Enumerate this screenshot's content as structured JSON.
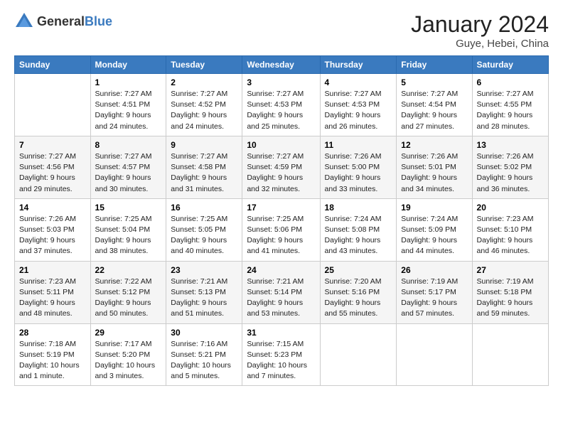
{
  "header": {
    "logo_general": "General",
    "logo_blue": "Blue",
    "month": "January 2024",
    "location": "Guye, Hebei, China"
  },
  "days_of_week": [
    "Sunday",
    "Monday",
    "Tuesday",
    "Wednesday",
    "Thursday",
    "Friday",
    "Saturday"
  ],
  "weeks": [
    [
      {
        "num": "",
        "info": ""
      },
      {
        "num": "1",
        "info": "Sunrise: 7:27 AM\nSunset: 4:51 PM\nDaylight: 9 hours\nand 24 minutes."
      },
      {
        "num": "2",
        "info": "Sunrise: 7:27 AM\nSunset: 4:52 PM\nDaylight: 9 hours\nand 24 minutes."
      },
      {
        "num": "3",
        "info": "Sunrise: 7:27 AM\nSunset: 4:53 PM\nDaylight: 9 hours\nand 25 minutes."
      },
      {
        "num": "4",
        "info": "Sunrise: 7:27 AM\nSunset: 4:53 PM\nDaylight: 9 hours\nand 26 minutes."
      },
      {
        "num": "5",
        "info": "Sunrise: 7:27 AM\nSunset: 4:54 PM\nDaylight: 9 hours\nand 27 minutes."
      },
      {
        "num": "6",
        "info": "Sunrise: 7:27 AM\nSunset: 4:55 PM\nDaylight: 9 hours\nand 28 minutes."
      }
    ],
    [
      {
        "num": "7",
        "info": "Sunrise: 7:27 AM\nSunset: 4:56 PM\nDaylight: 9 hours\nand 29 minutes."
      },
      {
        "num": "8",
        "info": "Sunrise: 7:27 AM\nSunset: 4:57 PM\nDaylight: 9 hours\nand 30 minutes."
      },
      {
        "num": "9",
        "info": "Sunrise: 7:27 AM\nSunset: 4:58 PM\nDaylight: 9 hours\nand 31 minutes."
      },
      {
        "num": "10",
        "info": "Sunrise: 7:27 AM\nSunset: 4:59 PM\nDaylight: 9 hours\nand 32 minutes."
      },
      {
        "num": "11",
        "info": "Sunrise: 7:26 AM\nSunset: 5:00 PM\nDaylight: 9 hours\nand 33 minutes."
      },
      {
        "num": "12",
        "info": "Sunrise: 7:26 AM\nSunset: 5:01 PM\nDaylight: 9 hours\nand 34 minutes."
      },
      {
        "num": "13",
        "info": "Sunrise: 7:26 AM\nSunset: 5:02 PM\nDaylight: 9 hours\nand 36 minutes."
      }
    ],
    [
      {
        "num": "14",
        "info": "Sunrise: 7:26 AM\nSunset: 5:03 PM\nDaylight: 9 hours\nand 37 minutes."
      },
      {
        "num": "15",
        "info": "Sunrise: 7:25 AM\nSunset: 5:04 PM\nDaylight: 9 hours\nand 38 minutes."
      },
      {
        "num": "16",
        "info": "Sunrise: 7:25 AM\nSunset: 5:05 PM\nDaylight: 9 hours\nand 40 minutes."
      },
      {
        "num": "17",
        "info": "Sunrise: 7:25 AM\nSunset: 5:06 PM\nDaylight: 9 hours\nand 41 minutes."
      },
      {
        "num": "18",
        "info": "Sunrise: 7:24 AM\nSunset: 5:08 PM\nDaylight: 9 hours\nand 43 minutes."
      },
      {
        "num": "19",
        "info": "Sunrise: 7:24 AM\nSunset: 5:09 PM\nDaylight: 9 hours\nand 44 minutes."
      },
      {
        "num": "20",
        "info": "Sunrise: 7:23 AM\nSunset: 5:10 PM\nDaylight: 9 hours\nand 46 minutes."
      }
    ],
    [
      {
        "num": "21",
        "info": "Sunrise: 7:23 AM\nSunset: 5:11 PM\nDaylight: 9 hours\nand 48 minutes."
      },
      {
        "num": "22",
        "info": "Sunrise: 7:22 AM\nSunset: 5:12 PM\nDaylight: 9 hours\nand 50 minutes."
      },
      {
        "num": "23",
        "info": "Sunrise: 7:21 AM\nSunset: 5:13 PM\nDaylight: 9 hours\nand 51 minutes."
      },
      {
        "num": "24",
        "info": "Sunrise: 7:21 AM\nSunset: 5:14 PM\nDaylight: 9 hours\nand 53 minutes."
      },
      {
        "num": "25",
        "info": "Sunrise: 7:20 AM\nSunset: 5:16 PM\nDaylight: 9 hours\nand 55 minutes."
      },
      {
        "num": "26",
        "info": "Sunrise: 7:19 AM\nSunset: 5:17 PM\nDaylight: 9 hours\nand 57 minutes."
      },
      {
        "num": "27",
        "info": "Sunrise: 7:19 AM\nSunset: 5:18 PM\nDaylight: 9 hours\nand 59 minutes."
      }
    ],
    [
      {
        "num": "28",
        "info": "Sunrise: 7:18 AM\nSunset: 5:19 PM\nDaylight: 10 hours\nand 1 minute."
      },
      {
        "num": "29",
        "info": "Sunrise: 7:17 AM\nSunset: 5:20 PM\nDaylight: 10 hours\nand 3 minutes."
      },
      {
        "num": "30",
        "info": "Sunrise: 7:16 AM\nSunset: 5:21 PM\nDaylight: 10 hours\nand 5 minutes."
      },
      {
        "num": "31",
        "info": "Sunrise: 7:15 AM\nSunset: 5:23 PM\nDaylight: 10 hours\nand 7 minutes."
      },
      {
        "num": "",
        "info": ""
      },
      {
        "num": "",
        "info": ""
      },
      {
        "num": "",
        "info": ""
      }
    ]
  ]
}
